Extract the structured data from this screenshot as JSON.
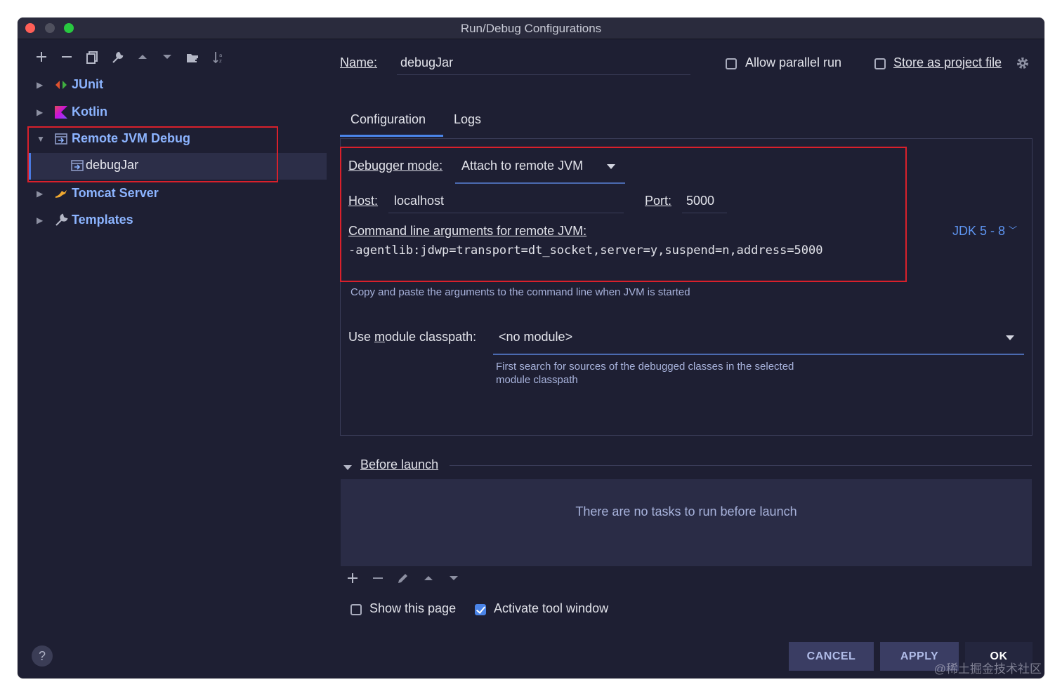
{
  "window": {
    "title": "Run/Debug Configurations"
  },
  "toolbar": {
    "icons": [
      "plus-icon",
      "minus-icon",
      "copy-icon",
      "wrench-icon",
      "arrow-up-icon",
      "arrow-down-icon",
      "folder-add-icon",
      "sort-icon"
    ]
  },
  "tree": {
    "items": [
      {
        "label": "JUnit",
        "icon": "junit-icon"
      },
      {
        "label": "Kotlin",
        "icon": "kotlin-icon"
      },
      {
        "label": "Remote JVM Debug",
        "icon": "remote-debug-icon"
      },
      {
        "label": "debugJar",
        "icon": "remote-debug-config-icon"
      },
      {
        "label": "Tomcat Server",
        "icon": "tomcat-icon"
      },
      {
        "label": "Templates",
        "icon": "wrench-icon"
      }
    ]
  },
  "header": {
    "name_label": "Name:",
    "name_value": "debugJar",
    "allow_parallel_label": "Allow parallel run",
    "store_project_label": "Store as project file"
  },
  "tabs": [
    {
      "label": "Configuration"
    },
    {
      "label": "Logs"
    }
  ],
  "config": {
    "debugger_mode_label": "Debugger mode:",
    "debugger_mode_value": "Attach to remote JVM",
    "host_label": "Host:",
    "host_value": "localhost",
    "port_label": "Port:",
    "port_value": "5000",
    "cmd_label": "Command line arguments for remote JVM:",
    "cmd_value": "-agentlib:jdwp=transport=dt_socket,server=y,suspend=n,address=5000",
    "jdk_label": "JDK 5 - 8",
    "cmd_hint": "Copy and paste the arguments to the command line when JVM is started",
    "module_label": "Use module classpath:",
    "module_value": "<no module>",
    "module_hint_1": "First search for sources of the debugged classes in the selected",
    "module_hint_2": "module classpath"
  },
  "before_launch": {
    "title": "Before launch",
    "empty_text": "There are no tasks to run before launch",
    "show_page_label": "Show this page",
    "activate_label": "Activate tool window",
    "show_page_checked": false,
    "activate_checked": true
  },
  "buttons": {
    "cancel": "CANCEL",
    "apply": "APPLY",
    "ok": "OK",
    "help": "?"
  },
  "watermark": "@稀土掘金技术社区"
}
